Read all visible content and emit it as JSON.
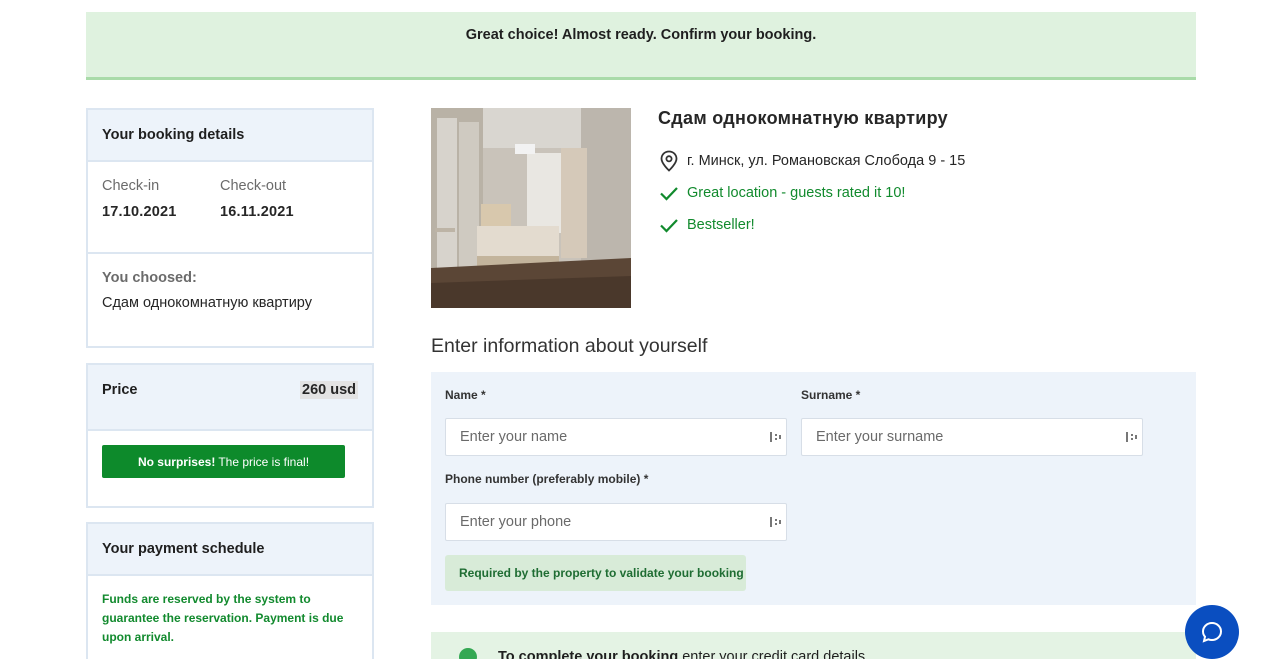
{
  "banner": {
    "text": "Great choice! Almost ready. Confirm your booking."
  },
  "booking": {
    "title": "Your booking details",
    "checkin_label": "Check-in",
    "checkin_value": "17.10.2021",
    "checkout_label": "Check-out",
    "checkout_value": "16.11.2021",
    "chosen_label": "You choosed:",
    "chosen_value": "Сдам однокомнатную квартиру"
  },
  "price": {
    "label": "Price",
    "value": "260 usd",
    "final_button_bold": "No surprises!",
    "final_button_rest": "The price is final!"
  },
  "schedule": {
    "title": "Your payment schedule",
    "text": "Funds are reserved by the system to guarantee the reservation. Payment is due upon arrival."
  },
  "property": {
    "title": "Сдам однокомнатную квартиру",
    "address": "г. Минск, ул. Романовская Слобода 9 - 15",
    "location_rating": "Great location - guests rated it 10!",
    "badge": "Bestseller!"
  },
  "form": {
    "section_title": "Enter information about yourself",
    "name_label": "Name *",
    "name_placeholder": "Enter your name",
    "surname_label": "Surname *",
    "surname_placeholder": "Enter your surname",
    "phone_label": "Phone number (preferably mobile) *",
    "phone_placeholder": "Enter your phone",
    "phone_hint": "Required by the property to validate your booking"
  },
  "credit_card": {
    "bold": "To complete your booking",
    "rest": "enter your credit card details"
  },
  "colors": {
    "accent_green": "#0d8a2b",
    "chat_blue": "#0a4ec0",
    "panel_blue": "#edf3fa",
    "banner_green": "#dff2df"
  },
  "icons": {
    "address": "map-pin-icon",
    "location": "checkmark-icon",
    "bestseller": "checkmark-icon",
    "chat": "chat-bubble-icon"
  }
}
